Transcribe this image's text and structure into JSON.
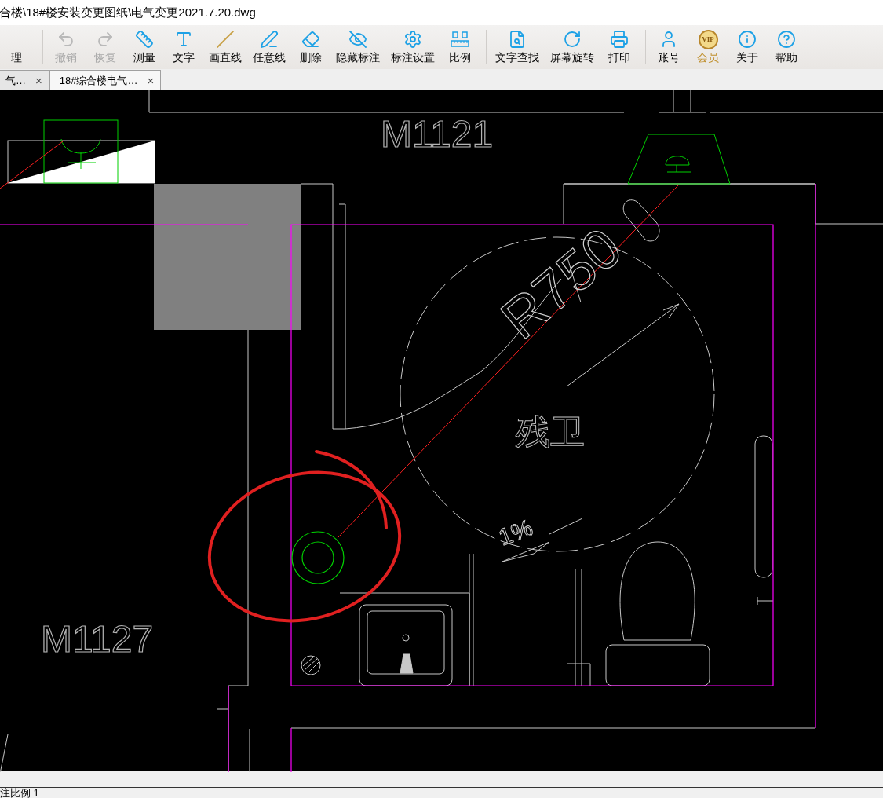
{
  "window": {
    "title": "合楼\\18#楼安装变更图纸\\电气变更2021.7.20.dwg"
  },
  "toolbar_groups": [
    [
      {
        "label": "理",
        "kind": "none",
        "disabled": false
      }
    ],
    [
      {
        "label": "撤销",
        "kind": "undo",
        "disabled": true
      },
      {
        "label": "恢复",
        "kind": "redo",
        "disabled": true
      },
      {
        "label": "测量",
        "kind": "ruler",
        "disabled": false
      },
      {
        "label": "文字",
        "kind": "text",
        "disabled": false
      },
      {
        "label": "画直线",
        "kind": "line",
        "disabled": false
      },
      {
        "label": "任意线",
        "kind": "pen",
        "disabled": false
      },
      {
        "label": "删除",
        "kind": "eraser",
        "disabled": false
      },
      {
        "label": "隐藏标注",
        "kind": "hide",
        "disabled": false
      },
      {
        "label": "标注设置",
        "kind": "settings",
        "disabled": false
      },
      {
        "label": "比例",
        "kind": "scale",
        "disabled": false
      }
    ],
    [
      {
        "label": "文字查找",
        "kind": "find",
        "disabled": false
      },
      {
        "label": "屏幕旋转",
        "kind": "rotate",
        "disabled": false
      },
      {
        "label": "打印",
        "kind": "printer",
        "disabled": false
      }
    ],
    [
      {
        "label": "账号",
        "kind": "user",
        "disabled": false
      },
      {
        "label": "会员",
        "kind": "vip",
        "badge": "VIP",
        "disabled": false
      },
      {
        "label": "关于",
        "kind": "info",
        "disabled": false
      },
      {
        "label": "帮助",
        "kind": "help",
        "disabled": false
      }
    ]
  ],
  "tabs": [
    {
      "label": "气…",
      "close": "×",
      "selected": false
    },
    {
      "label": "18#综合楼电气…",
      "close": "×",
      "selected": true
    }
  ],
  "drawing": {
    "door_labels": [
      "M1121",
      "M1127"
    ],
    "radius_label": "R750",
    "room_label": "残卫",
    "slope_label": "1%"
  },
  "status_bar": {
    "text": "注比例 1"
  }
}
